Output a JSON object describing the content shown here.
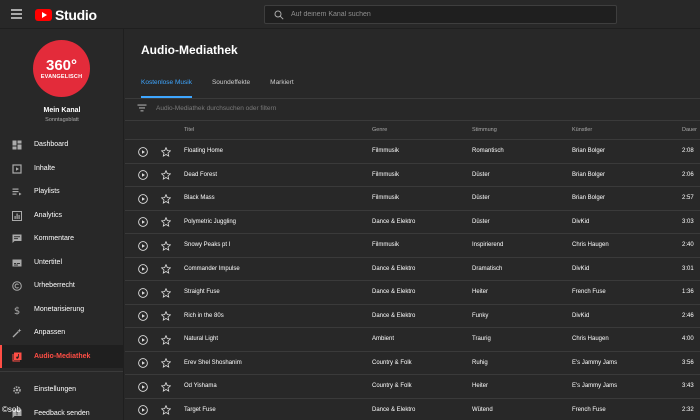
{
  "app": {
    "logo_text": "Studio",
    "search_placeholder": "Auf deinem Kanal suchen"
  },
  "colors": {
    "background": "#282828",
    "accent_blue": "#3ea6ff",
    "active_red": "#ff4e45",
    "avatar_red": "#e32b3a",
    "logo_red": "#ff0000"
  },
  "channel": {
    "avatar_big": "360°",
    "avatar_small": "EVANGELISCH",
    "name": "Mein Kanal",
    "subtitle": "Sonntagsblatt"
  },
  "sidebar": {
    "items": [
      {
        "label": "Dashboard",
        "icon": "dashboard-icon",
        "active": false
      },
      {
        "label": "Inhalte",
        "icon": "content-icon",
        "active": false
      },
      {
        "label": "Playlists",
        "icon": "playlist-icon",
        "active": false
      },
      {
        "label": "Analytics",
        "icon": "analytics-icon",
        "active": false
      },
      {
        "label": "Kommentare",
        "icon": "comments-icon",
        "active": false
      },
      {
        "label": "Untertitel",
        "icon": "subtitles-icon",
        "active": false
      },
      {
        "label": "Urheberrecht",
        "icon": "copyright-icon",
        "active": false
      },
      {
        "label": "Monetarisierung",
        "icon": "dollar-icon",
        "active": false
      },
      {
        "label": "Anpassen",
        "icon": "magic-wand-icon",
        "active": false
      },
      {
        "label": "Audio-Mediathek",
        "icon": "audio-library-icon",
        "active": true
      }
    ],
    "bottom_items": [
      {
        "label": "Einstellungen",
        "icon": "gear-icon"
      },
      {
        "label": "Feedback senden",
        "icon": "feedback-icon"
      }
    ]
  },
  "main": {
    "title": "Audio-Mediathek",
    "tabs": [
      {
        "label": "Kostenlose Musik",
        "active": true
      },
      {
        "label": "Soundeffekte",
        "active": false
      },
      {
        "label": "Markiert",
        "active": false
      }
    ],
    "filter_placeholder": "Audio-Mediathek durchsuchen oder filtern",
    "columns": {
      "title": "Titel",
      "genre": "Genre",
      "mood": "Stimmung",
      "artist": "Künstler",
      "duration": "Dauer"
    },
    "rows": [
      {
        "title": "Floating Home",
        "genre": "Filmmusik",
        "mood": "Romantisch",
        "artist": "Brian Bolger",
        "duration": "2:08"
      },
      {
        "title": "Dead Forest",
        "genre": "Filmmusik",
        "mood": "Düster",
        "artist": "Brian Bolger",
        "duration": "2:06"
      },
      {
        "title": "Black Mass",
        "genre": "Filmmusik",
        "mood": "Düster",
        "artist": "Brian Bolger",
        "duration": "2:57"
      },
      {
        "title": "Polymetric Juggling",
        "genre": "Dance & Elektro",
        "mood": "Düster",
        "artist": "DivKid",
        "duration": "3:03"
      },
      {
        "title": "Snowy Peaks pt I",
        "genre": "Filmmusik",
        "mood": "Inspirierend",
        "artist": "Chris Haugen",
        "duration": "2:40"
      },
      {
        "title": "Commander Impulse",
        "genre": "Dance & Elektro",
        "mood": "Dramatisch",
        "artist": "DivKid",
        "duration": "3:01"
      },
      {
        "title": "Straight Fuse",
        "genre": "Dance & Elektro",
        "mood": "Heiter",
        "artist": "French Fuse",
        "duration": "1:36"
      },
      {
        "title": "Rich in the 80s",
        "genre": "Dance & Elektro",
        "mood": "Funky",
        "artist": "DivKid",
        "duration": "2:46"
      },
      {
        "title": "Natural Light",
        "genre": "Ambient",
        "mood": "Traurig",
        "artist": "Chris Haugen",
        "duration": "4:00"
      },
      {
        "title": "Erev Shel Shoshanim",
        "genre": "Country & Folk",
        "mood": "Ruhig",
        "artist": "E's Jammy Jams",
        "duration": "3:56"
      },
      {
        "title": "Od Yishama",
        "genre": "Country & Folk",
        "mood": "Heiter",
        "artist": "E's Jammy Jams",
        "duration": "3:43"
      },
      {
        "title": "Target Fuse",
        "genre": "Dance & Elektro",
        "mood": "Wütend",
        "artist": "French Fuse",
        "duration": "2:32"
      }
    ]
  },
  "watermark": "©sob"
}
